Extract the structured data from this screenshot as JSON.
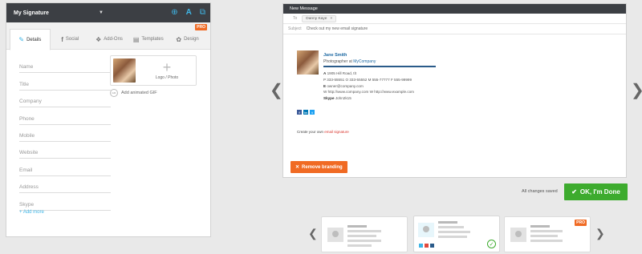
{
  "editor": {
    "signature_name": "My Signature",
    "tabs": [
      {
        "label": "Details",
        "icon": "pencil-icon"
      },
      {
        "label": "Social",
        "icon": "facebook-icon"
      },
      {
        "label": "Add-Ons",
        "icon": "puzzle-icon"
      },
      {
        "label": "Templates",
        "icon": "template-icon"
      },
      {
        "label": "Design",
        "icon": "palette-icon",
        "badge": "PRO"
      }
    ],
    "fields": [
      "Name",
      "Title",
      "Company",
      "Phone",
      "Mobile",
      "Website",
      "Email",
      "Address",
      "Skype"
    ],
    "add_more": "+ Add more",
    "logo_label": "Logo / Photo",
    "gif_label": "Add animated GIF",
    "gif_icon_text": "GIF"
  },
  "preview": {
    "header": "New Message",
    "to_label": "To",
    "to_recipient": "Danny Kaye",
    "subject_label": "Subject",
    "subject": "Check out my new email signature",
    "signature": {
      "name": "Jane Smith",
      "title": "Photographer at",
      "company": "MyCompany",
      "address_label": "A",
      "address": "1905 Hill Road, tlt",
      "phones_line": "P 333-55551  O 333-55552  M 555-77777  F 555-99999",
      "email_label": "E",
      "email": "owner@company.com",
      "web_line": "W http://www.company.com  W http://www.example.com",
      "skype_label": "Skype",
      "skype": "John2k15"
    },
    "social": [
      "f",
      "in",
      "t"
    ],
    "create_own_prefix": "Create your own",
    "create_own_link": "email signature",
    "remove_branding": "Remove branding"
  },
  "status": "All changes saved",
  "done_button": "OK, I'm Done",
  "templates_pro_badge": "PRO",
  "colors": {
    "accent": "#3fb6e6",
    "orange": "#f06a23",
    "green": "#3dab2e",
    "dark": "#3c3f44"
  }
}
